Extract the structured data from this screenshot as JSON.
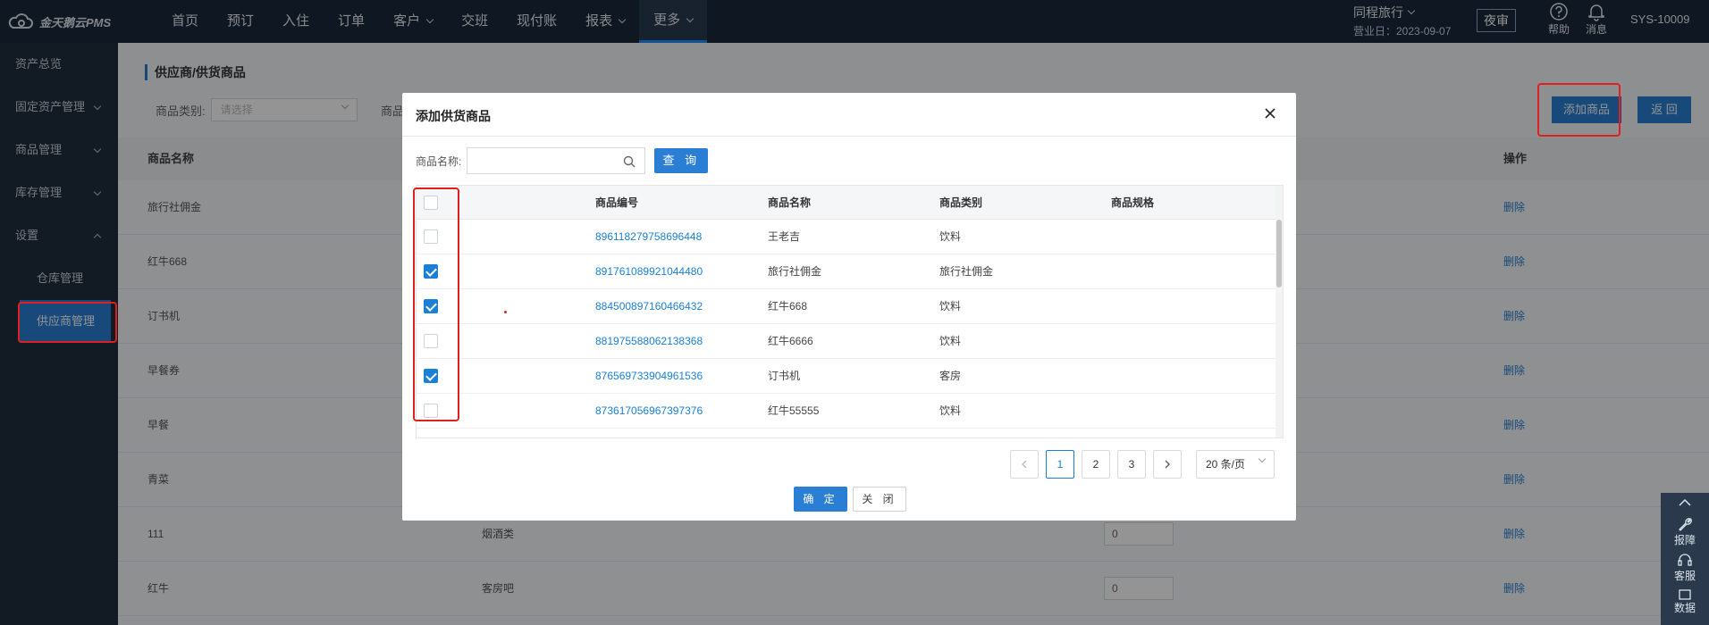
{
  "app": {
    "name": "金天鹅云PMS"
  },
  "nav": {
    "items": [
      {
        "label": "首页",
        "dropdown": false
      },
      {
        "label": "预订",
        "dropdown": false
      },
      {
        "label": "入住",
        "dropdown": false
      },
      {
        "label": "订单",
        "dropdown": false
      },
      {
        "label": "客户",
        "dropdown": true
      },
      {
        "label": "交班",
        "dropdown": false
      },
      {
        "label": "现付账",
        "dropdown": false
      },
      {
        "label": "报表",
        "dropdown": true
      },
      {
        "label": "更多",
        "dropdown": true,
        "active": true
      }
    ]
  },
  "header": {
    "hotel_name": "同程旅行",
    "business_date": "营业日：2023-09-07",
    "night_audit": "夜审",
    "help": "帮助",
    "messages": "消息",
    "user": "SYS-10009"
  },
  "sidebar": {
    "items": [
      {
        "label": "资产总览",
        "arrow": "none"
      },
      {
        "label": "固定资产管理",
        "arrow": "down"
      },
      {
        "label": "商品管理",
        "arrow": "down"
      },
      {
        "label": "库存管理",
        "arrow": "down"
      },
      {
        "label": "设置",
        "arrow": "up"
      },
      {
        "label": "仓库管理",
        "arrow": "sub"
      },
      {
        "label": "供应商管理",
        "arrow": "active"
      }
    ]
  },
  "page": {
    "title": "供应商/供货商品",
    "filter_category_label": "商品类别:",
    "filter_category_placeholder": "请选择",
    "filter2_label": "商品",
    "add_button": "添加商品",
    "back_button": "返 回",
    "table": {
      "headers": {
        "name": "商品名称",
        "action": "操作"
      },
      "rows": [
        {
          "name": "旅行社佣金",
          "category": "",
          "qty": ""
        },
        {
          "name": "红牛668",
          "category": "",
          "qty": ""
        },
        {
          "name": "订书机",
          "category": "",
          "qty": ""
        },
        {
          "name": "早餐券",
          "category": "",
          "qty": ""
        },
        {
          "name": "早餐",
          "category": "",
          "qty": ""
        },
        {
          "name": "青菜",
          "category": "",
          "qty": ""
        },
        {
          "name": "111",
          "category": "烟酒类",
          "qty": "0"
        },
        {
          "name": "红牛",
          "category": "客房吧",
          "qty": "0"
        }
      ],
      "delete_label": "删除"
    }
  },
  "modal": {
    "title": "添加供货商品",
    "search_label": "商品名称:",
    "search_value": "",
    "query_button": "查 询",
    "columns": [
      "商品编号",
      "商品名称",
      "商品类别",
      "商品规格"
    ],
    "rows": [
      {
        "code": "896118279758696448",
        "name": "王老吉",
        "category": "饮料",
        "spec": "",
        "checked": false
      },
      {
        "code": "891761089921044480",
        "name": "旅行社佣金",
        "category": "旅行社佣金",
        "spec": "",
        "checked": true
      },
      {
        "code": "884500897160466432",
        "name": "红牛668",
        "category": "饮料",
        "spec": "",
        "checked": true
      },
      {
        "code": "881975588062138368",
        "name": "红牛6666",
        "category": "饮料",
        "spec": "",
        "checked": false
      },
      {
        "code": "876569733904961536",
        "name": "订书机",
        "category": "客房",
        "spec": "",
        "checked": true
      },
      {
        "code": "873617056967397376",
        "name": "红牛55555",
        "category": "饮料",
        "spec": "",
        "checked": false
      }
    ],
    "pager": {
      "pages": [
        "1",
        "2",
        "3"
      ],
      "current": "1",
      "page_size": "20 条/页"
    },
    "ok_button": "确 定",
    "close_button": "关 闭"
  },
  "float_tools": {
    "report": "报障",
    "service": "客服",
    "data": "数据"
  },
  "colors": {
    "nav_bg": "#1b2a3b",
    "sidebar_bg": "#1f2d3d",
    "primary": "#2a7fd4",
    "highlight": "#e02020"
  }
}
